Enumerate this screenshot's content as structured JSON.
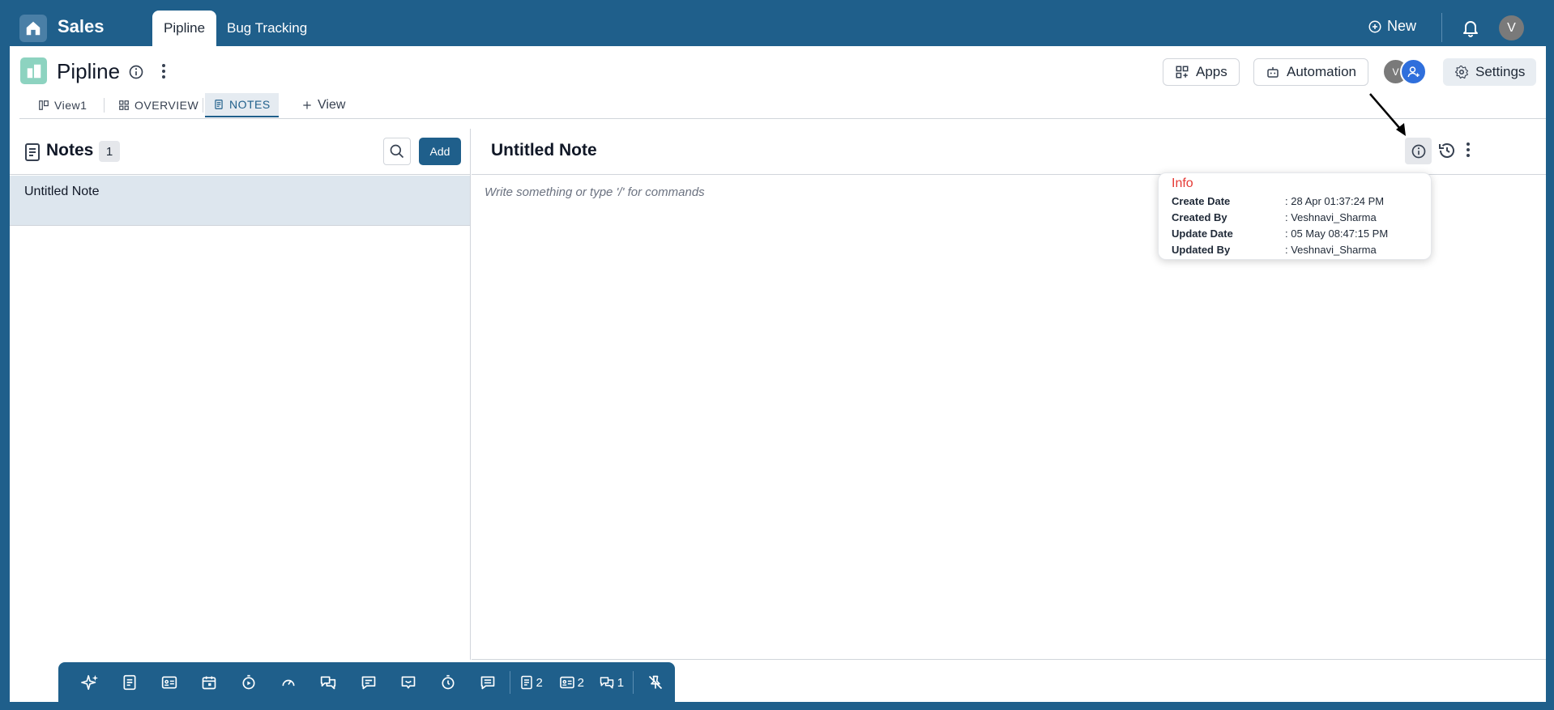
{
  "topbar": {
    "app_title": "Sales",
    "tabs": [
      {
        "label": "Pipline",
        "active": true
      },
      {
        "label": "Bug Tracking",
        "active": false
      }
    ],
    "new_label": "New",
    "user_initial": "V"
  },
  "project": {
    "title": "Pipline",
    "buttons": {
      "apps": "Apps",
      "automation": "Automation",
      "settings": "Settings"
    },
    "member_initial": "V"
  },
  "view_tabs": [
    {
      "label": "View1",
      "icon": "board-icon"
    },
    {
      "label": "OVERVIEW",
      "icon": "grid-icon"
    },
    {
      "label": "NOTES",
      "icon": "note-icon",
      "active": true
    },
    {
      "label": "View",
      "icon": "plus-icon"
    }
  ],
  "notes_panel": {
    "title": "Notes",
    "count": "1",
    "add_label": "Add",
    "items": [
      {
        "title": "Untitled Note",
        "selected": true
      }
    ]
  },
  "editor": {
    "title": "Untitled Note",
    "placeholder": "Write something or type '/' for commands"
  },
  "info_popover": {
    "title": "Info",
    "rows": [
      {
        "label": "Create Date",
        "value": ": 28 Apr 01:37:24 PM"
      },
      {
        "label": "Created By",
        "value": ": Veshnavi_Sharma"
      },
      {
        "label": "Update Date",
        "value": ": 05 May 08:47:15 PM"
      },
      {
        "label": "Updated By",
        "value": ":  Veshnavi_Sharma"
      }
    ]
  },
  "bottom_toolbar": {
    "items": [
      "ai-sparkle-icon",
      "notes-icon",
      "card-icon",
      "calendar-icon",
      "timer-play-icon",
      "gauge-icon",
      "chat-icon",
      "message-icon",
      "comment-icon",
      "stopwatch-icon",
      "chat-lines-icon"
    ],
    "counters": [
      {
        "icon": "notes-icon",
        "count": "2"
      },
      {
        "icon": "card-icon",
        "count": "2"
      },
      {
        "icon": "chat-icon",
        "count": "1"
      }
    ]
  },
  "colors": {
    "brand": "#1f5f8b",
    "info_title": "#e53935",
    "selected_row": "#dde6ee"
  }
}
